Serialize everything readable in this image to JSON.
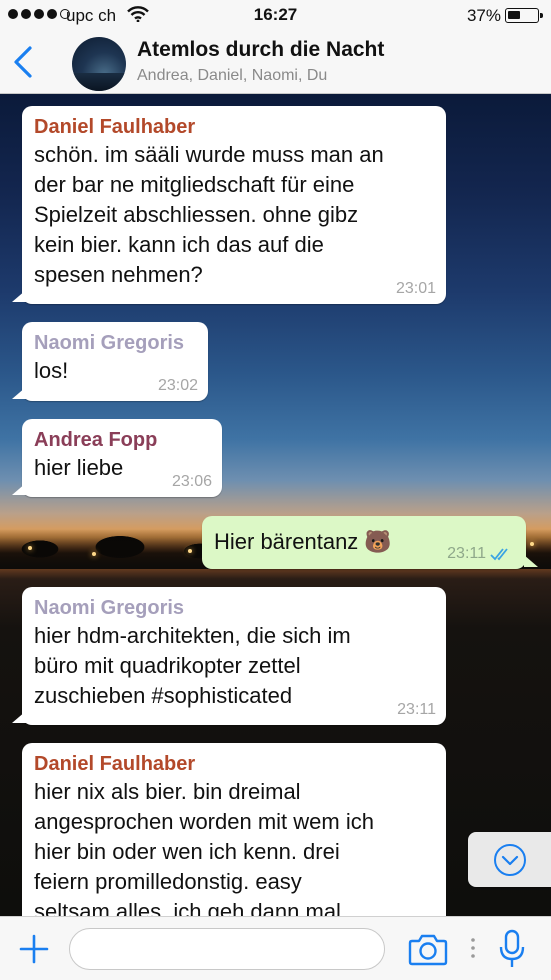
{
  "status_bar": {
    "carrier": "upc ch",
    "time": "16:27",
    "battery": "37%"
  },
  "header": {
    "title": "Atemlos durch die Nacht",
    "members": "Andrea, Daniel, Naomi, Du"
  },
  "colors": {
    "accent": "#1a7ff0",
    "outgoing_bubble": "#dcf8c6",
    "incoming_bubble": "#ffffff",
    "sender_daniel": "#b3492a",
    "sender_naomi": "#a59fbb",
    "sender_andrea": "#8a3e58"
  },
  "messages": [
    {
      "direction": "in",
      "sender": "Daniel Faulhaber",
      "lines": [
        "schön. im sääli wurde muss man an",
        "der bar ne mitgliedschaft für eine",
        "Spielzeit abschliessen. ohne gibz",
        "kein bier. kann ich das auf die",
        "spesen nehmen?"
      ],
      "time": "23:01"
    },
    {
      "direction": "in",
      "sender": "Naomi Gregoris",
      "lines": [
        "los!"
      ],
      "time": "23:02"
    },
    {
      "direction": "in",
      "sender": "Andrea Fopp",
      "lines": [
        "hier liebe"
      ],
      "time": "23:06"
    },
    {
      "direction": "out",
      "lines": [
        "Hier bärentanz 🐻"
      ],
      "time": "23:11",
      "status": "read"
    },
    {
      "direction": "in",
      "sender": "Naomi Gregoris",
      "lines": [
        "hier hdm-architekten, die sich im",
        "büro mit quadrikopter zettel",
        "zuschieben #sophisticated"
      ],
      "time": "23:11"
    },
    {
      "direction": "in",
      "sender": "Daniel Faulhaber",
      "lines": [
        "hier nix als bier. bin dreimal",
        "angesprochen worden mit wem ich",
        "hier bin oder wen ich kenn. drei",
        "feiern promilledonstig. easy",
        "seltsam alles. ich geh dann mal"
      ],
      "time": ""
    }
  ],
  "input": {
    "value": "",
    "placeholder": ""
  }
}
